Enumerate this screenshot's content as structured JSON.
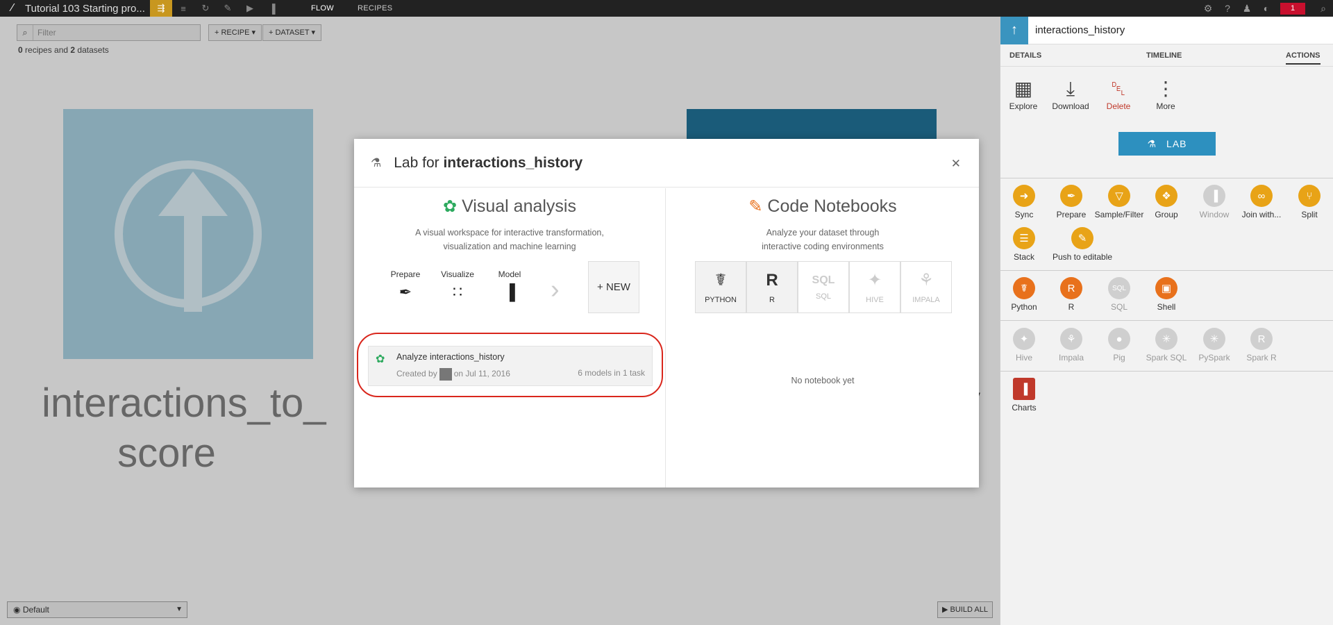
{
  "topbar": {
    "project_title": "Tutorial 103 Starting pro...",
    "tabs": [
      "FLOW",
      "RECIPES"
    ],
    "notification_count": "1"
  },
  "flow": {
    "filter_placeholder": "Filter",
    "recipe_button": "+ RECIPE",
    "dataset_button": "+ DATASET",
    "counts_recipes": "0",
    "counts_text_mid": " recipes and ",
    "counts_datasets": "2",
    "counts_text_end": " datasets",
    "dataset_name_line1": "interactions_to_",
    "dataset_name_line2": "score",
    "partial_text": "y",
    "view_select": "Default",
    "build_all": "BUILD ALL"
  },
  "panel": {
    "title": "interactions_history",
    "tabs": [
      "DETAILS",
      "TIMELINE",
      "ACTIONS"
    ],
    "actions": [
      "Explore",
      "Download",
      "Delete",
      "More"
    ],
    "lab_button": "LAB",
    "visual_recipes": [
      {
        "label": "Sync",
        "color": "#e8a317",
        "icon": "sync-icon"
      },
      {
        "label": "Prepare",
        "color": "#e8a317",
        "icon": "prepare-icon"
      },
      {
        "label": "Sample/Filter",
        "color": "#e8a317",
        "icon": "filter-icon"
      },
      {
        "label": "Group",
        "color": "#e8a317",
        "icon": "group-icon"
      },
      {
        "label": "Window",
        "color": "#cfcfcf",
        "icon": "window-icon"
      },
      {
        "label": "Join with...",
        "color": "#e8a317",
        "icon": "join-icon"
      },
      {
        "label": "Split",
        "color": "#e8a317",
        "icon": "split-icon"
      },
      {
        "label": "Stack",
        "color": "#e8a317",
        "icon": "stack-icon"
      },
      {
        "label": "Push to editable",
        "color": "#e8a317",
        "icon": "push-icon"
      }
    ],
    "code_recipes": [
      {
        "label": "Python",
        "color": "#e8711c",
        "icon": "python-icon"
      },
      {
        "label": "R",
        "color": "#e8711c",
        "icon": "r-icon"
      },
      {
        "label": "SQL",
        "color": "#cfcfcf",
        "icon": "sql-icon"
      },
      {
        "label": "Shell",
        "color": "#e8711c",
        "icon": "shell-icon"
      }
    ],
    "other_recipes": [
      "Hive",
      "Impala",
      "Pig",
      "Spark SQL",
      "PySpark",
      "Spark R"
    ],
    "charts_label": "Charts"
  },
  "modal": {
    "title_prefix": "Lab for ",
    "title_dataset": "interactions_history",
    "visual": {
      "title": "Visual analysis",
      "desc_line1": "A visual workspace for interactive transformation,",
      "desc_line2": "visualization and machine learning",
      "steps": [
        "Prepare",
        "Visualize",
        "Model"
      ],
      "new_button": "+ NEW"
    },
    "analysis": {
      "name": "Analyze interactions_history",
      "created_by": "Created by",
      "date": "on Jul 11, 2016",
      "models": "6 models in 1 task"
    },
    "code": {
      "title": "Code Notebooks",
      "desc_line1": "Analyze your dataset through",
      "desc_line2": "interactive coding environments",
      "languages": [
        "PYTHON",
        "R",
        "SQL",
        "HIVE",
        "IMPALA"
      ],
      "empty_text": "No notebook yet"
    }
  }
}
